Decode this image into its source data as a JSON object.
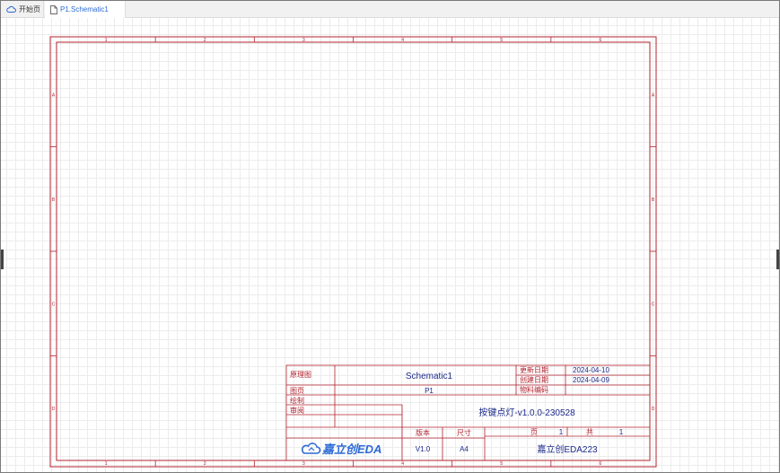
{
  "tabs": [
    {
      "label": "开始页",
      "icon": "cloud-icon"
    },
    {
      "label": "P1.Schematic1",
      "icon": "document-icon"
    }
  ],
  "border": {
    "columns": [
      "1",
      "2",
      "3",
      "4",
      "5",
      "6"
    ],
    "rows": [
      "A",
      "B",
      "C",
      "D"
    ]
  },
  "title_block": {
    "label_schematic": "原理图",
    "schematic_name": "Schematic1",
    "label_update_date": "更新日期",
    "update_date": "2024-04-10",
    "label_create_date": "创建日期",
    "create_date": "2024-04-09",
    "label_page": "图页",
    "page_name": "P1",
    "label_part_number": "物料编码",
    "label_drawn": "绘制",
    "label_review": "审阅",
    "project_name": "按键点灯-v1.0.0-230528",
    "label_version": "版本",
    "label_size": "尺寸",
    "label_page_no": "页",
    "page_no": "1",
    "label_total": "共",
    "total_pages": "1",
    "version": "V1.0",
    "size": "A4",
    "company": "嘉立创EDA223",
    "logo_text": "嘉立创EDA"
  },
  "colors": {
    "border_red": "#b3232f",
    "tab_active": "#2d6ad6",
    "value_blue": "#1c2a8a",
    "logo_blue": "#2d6ad6"
  }
}
